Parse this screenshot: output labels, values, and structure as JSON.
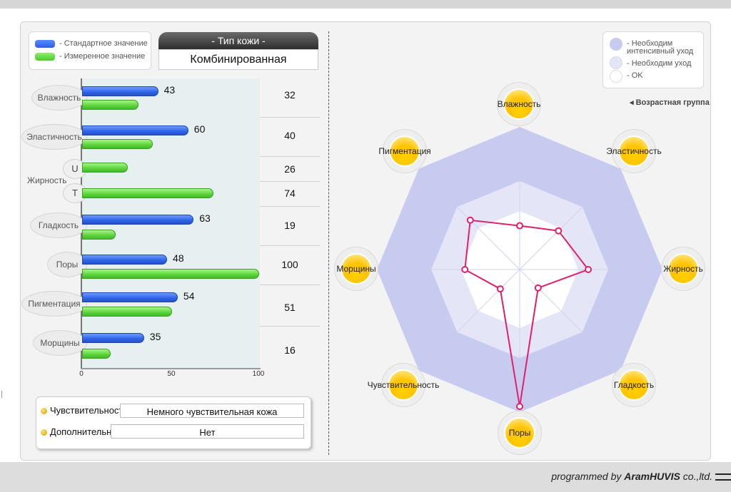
{
  "legend": {
    "standard": "- Стандартное значение",
    "measured": "- Измеренное значение"
  },
  "skin_type": {
    "title": "- Тип кожи -",
    "value": "Комбинированная"
  },
  "chart_data": {
    "type": "bar",
    "categories": [
      "Влажность",
      "Эластичность",
      "Жирность U",
      "Жирность T",
      "Гладкость",
      "Поры",
      "Пигментация",
      "Морщины"
    ],
    "series": [
      {
        "name": "Стандартное значение",
        "values": [
          43,
          60,
          null,
          null,
          63,
          48,
          54,
          35
        ]
      },
      {
        "name": "Измеренное значение",
        "values": [
          32,
          40,
          26,
          74,
          19,
          100,
          51,
          16
        ]
      }
    ],
    "ticks": [
      "0",
      "50",
      "100"
    ],
    "xlim": [
      0,
      100
    ]
  },
  "categories": {
    "vlazhnost": "Влажность",
    "elastichnost": "Эластичность",
    "zhirnost": "Жирность",
    "zhirnost_u": "U",
    "zhirnost_t": "T",
    "gladkost": "Гладкость",
    "pory": "Поры",
    "pigmentaciya": "Пигментация",
    "morshchiny": "Морщины"
  },
  "standard_labels": [
    "43",
    "60",
    "63",
    "48",
    "54",
    "35"
  ],
  "measured_labels": [
    "32",
    "40",
    "26",
    "74",
    "19",
    "100",
    "51",
    "16"
  ],
  "info": {
    "sensitivity_label": "Чувствительность",
    "sensitivity_value": "Немного чувствительная кожа",
    "additional_label": "Дополнительно",
    "additional_value": "Нет"
  },
  "radar": {
    "legend": {
      "intensive": "- Необходим интенсивный уход",
      "care": "- Необходим уход",
      "ok": "- OK"
    },
    "age_group": "◂ Возрастная группа",
    "axes": [
      "Влажность",
      "Эластичность",
      "Жирность",
      "Гладкость",
      "Поры",
      "Чувствительность",
      "Морщины",
      "Пигментация"
    ],
    "values": [
      32,
      40,
      50,
      19,
      100,
      20,
      40,
      51
    ],
    "colors": {
      "intensive": "#c8cbf0",
      "care": "#e4e6f7",
      "ok": "#ffffff",
      "line": "#e0206a"
    }
  },
  "footer": {
    "prefix": "programmed by ",
    "company": "AramHUVIS",
    "suffix": " co.,ltd."
  }
}
